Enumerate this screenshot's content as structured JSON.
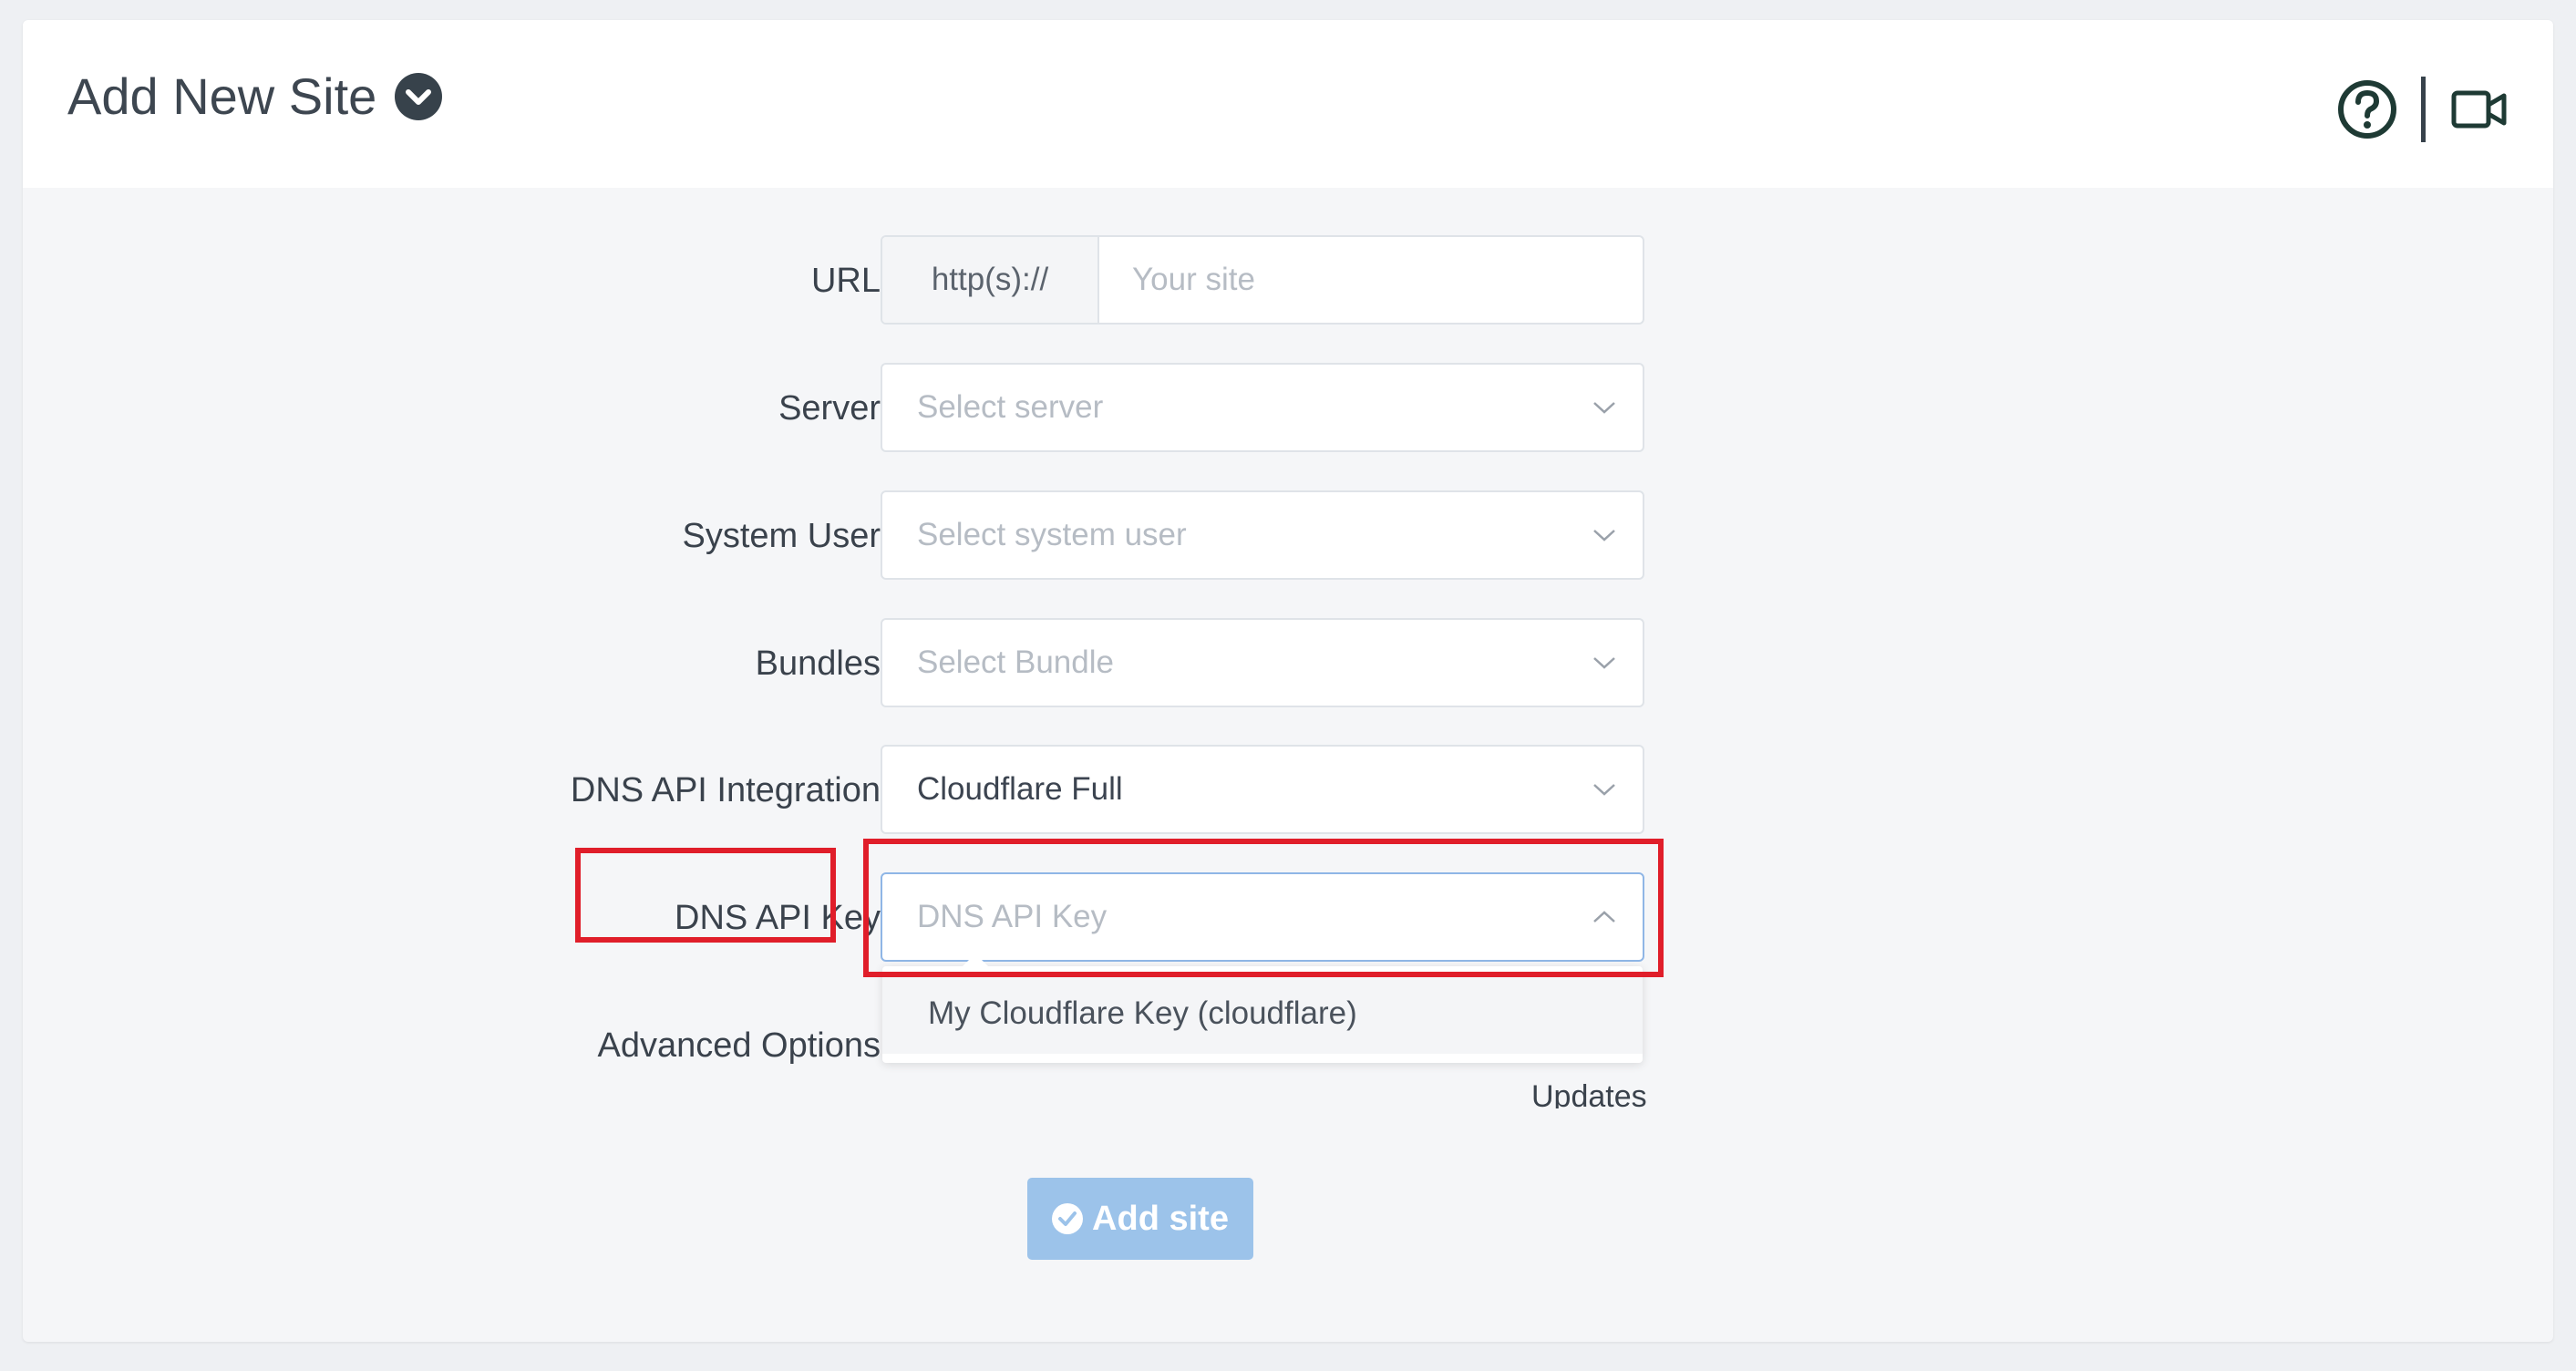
{
  "header": {
    "title": "Add New Site",
    "title_icon": "chevron-down-circle-icon",
    "help_icon": "question-circle-icon",
    "video_icon": "video-camera-icon"
  },
  "form": {
    "url": {
      "label": "URL",
      "prefix": "http(s)://",
      "placeholder": "Your site"
    },
    "server": {
      "label": "Server",
      "placeholder": "Select server"
    },
    "system_user": {
      "label": "System User",
      "placeholder": "Select system user"
    },
    "bundles": {
      "label": "Bundles",
      "placeholder": "Select Bundle"
    },
    "dns_integration": {
      "label": "DNS API Integration",
      "value": "Cloudflare Full"
    },
    "dns_api_key": {
      "label": "DNS API Key",
      "placeholder": "DNS API Key",
      "options": [
        "My Cloudflare Key (cloudflare)"
      ]
    },
    "advanced_options": {
      "label": "Advanced Options",
      "partial_text": "Updates"
    }
  },
  "submit": {
    "label": "Add site",
    "icon": "check-circle-icon"
  },
  "colors": {
    "highlight": "#e01e2a",
    "button": "#9cc3ea",
    "active_border": "#8fb6e6"
  }
}
